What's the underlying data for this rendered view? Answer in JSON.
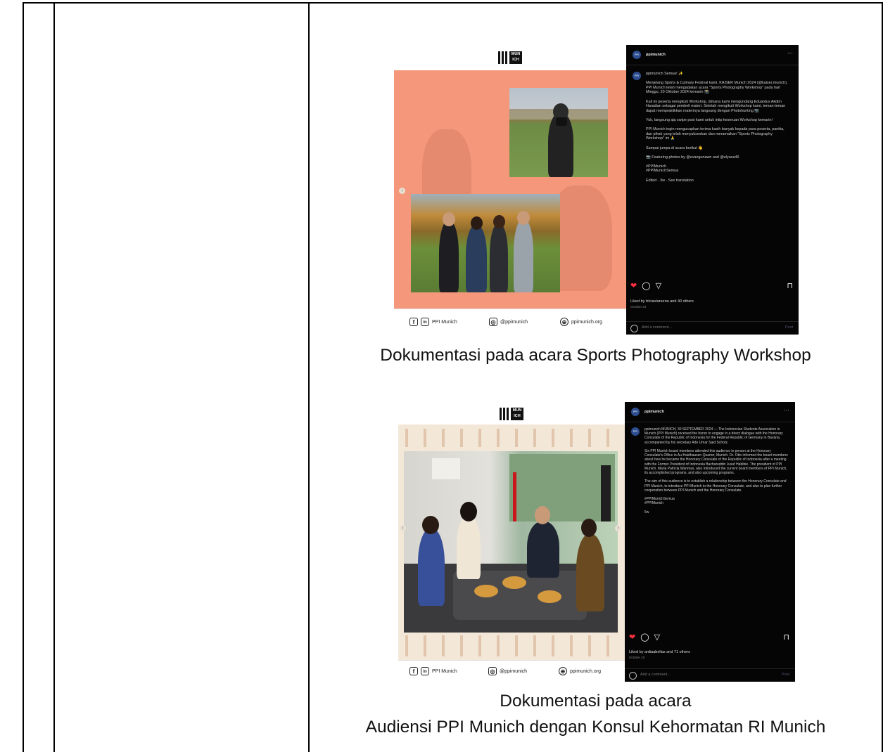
{
  "captions": {
    "first": "Dokumentasi pada acara Sports Photography Workshop",
    "second_line1": "Dokumentasi pada acara",
    "second_line2": "Audiensi PPI Munich dengan Konsul Kehormatan RI Munich"
  },
  "post1": {
    "logo_text": "MUN ICH",
    "username": "ppimunich",
    "caption": "ppimunich Semua! ✨\n\nMenjelang Sports & Culinary Festival kami, KAISER Munich 2024 (@kaiser.munich), PPI Munich telah mengadakan acara \"Sports Photography Workshop\" pada hari Minggu, 20 Oktober 2024 kemarin 📸\n\nKali ini peserta mengikuti Workshop, dimana kami mengundang Eduardus Akdim Haradian sebagai pembeli materi. Setelah mengikuti Workshop kami, teman-teman dapat mempraktikkan materinya langsung dengan Photohunting 📷\n\nYuk, langsung aja swipe post kami untuk intip keseruan Workshop kemarin!\n\nPPI Munich ingin mengucapkan terima kasih banyak kepada para peserta, panitia, dan pihak yang telah menyukseskan dan meramaikan \"Sports Photography Workshop\" ini 🙏\n\nSampai jumpa di acara berikut 👋\n\n📷 Featuring photos by @evangunawn and @elyasa46\n\n#PPIMunich\n#PPIMunichSemua\n\nEdited · 3w · See translation",
    "likes": "Liked by triciavlareena and 40 others",
    "date": "October 24",
    "comment_placeholder": "Add a comment...",
    "post_button": "Post"
  },
  "post2": {
    "logo_text": "MUN ICH",
    "username": "ppimunich",
    "caption": "ppimunich MUNICH, 30 SEPTEMBER 2024 — The Indonesian Students Association in Munich (PPI Munich) received the honor to engage in a direct dialogue with the Honorary Consulate of the Republic of Indonesia for the Federal Republic of Germany in Bavaria, accompanied by his secretary Ade Umar Said Schotz.\n\nSix PPI Munich board members attended this audience in person at the Honorary Consulate's Office in Au-Haidhausen Quarter, Munich. Dr. Otto informed the board members about how he became the Honorary Consulate of the Republic of Indonesia after a meeting with the Former President of Indonesia Bacharuddin Jusuf Habibie. The president of PPI Munich, Maria Patricia Wanmas, also introduced the current board members of PPI Munich, its accomplished programs, and also upcoming programs.\n\nThe aim of this audience is to establish a relationship between the Honorary Consulate and PPI Munich, to introduce PPI Munich to the Honorary Consulate, and also to plan further cooperation between PPI Munich and the Honorary Consulate.\n\n#PPIMunichSemua\n#PPIMunich\n\n5w",
    "likes": "Liked by ardiaabellas and 71 others",
    "date": "October 10",
    "comment_placeholder": "Add a comment...",
    "post_button": "Post"
  },
  "footer": {
    "social_name": "PPI Munich",
    "instagram": "@ppimunich",
    "website": "ppimunich.org",
    "fb": "f",
    "li": "in",
    "ig": "◎",
    "web": "⊕"
  },
  "icons": {
    "heart": "❤",
    "comment": "◯",
    "share": "▽",
    "save": "⊓",
    "more": "···",
    "chev_left": "‹",
    "chev_right": "›"
  },
  "colors": {
    "coral": "#f4977a",
    "ig_bg": "#050505",
    "beige": "#f3e7d8"
  }
}
